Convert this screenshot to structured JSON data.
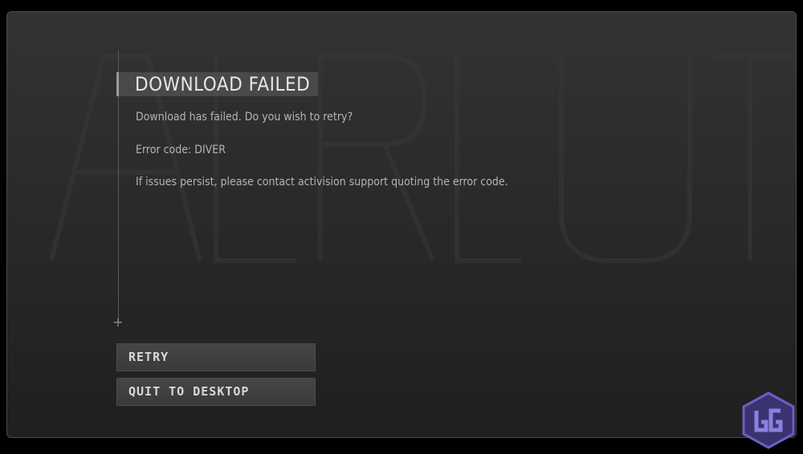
{
  "dialog": {
    "title": "DOWNLOAD FAILED",
    "message": "Download has failed. Do you wish to retry?",
    "error_code_line": "Error code: DIVER",
    "support_line": "If issues persist, please contact activision support quoting the error code."
  },
  "buttons": {
    "retry_label": "RETRY",
    "quit_label": "QUIT TO DESKTOP"
  },
  "icons": {
    "divider_marker": "+"
  },
  "colors": {
    "background": "#2a2a2a",
    "text": "#b4b4b4",
    "title_text": "#e6e6e6",
    "button_bg": "#404040",
    "logo": "#5b4fa8"
  }
}
